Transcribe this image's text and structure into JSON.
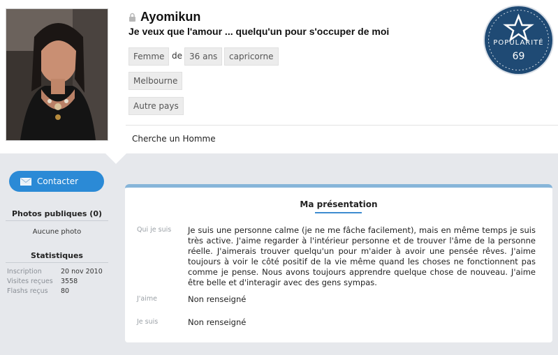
{
  "profile": {
    "name": "Ayomikun",
    "tagline": "Je veux que l'amour ... quelqu'un pour s'occuper de moi",
    "gender": "Femme",
    "age_connector": "de",
    "age": "36 ans",
    "sign": "capricorne",
    "city": "Melbourne",
    "country": "Autre pays",
    "looking_for": "Cherche un Homme"
  },
  "popularity": {
    "label": "POPULARITÉ",
    "value": "69"
  },
  "sidebar": {
    "contact_label": "Contacter",
    "photos_title": "Photos publiques (0)",
    "photos_empty": "Aucune photo",
    "stats_title": "Statistiques",
    "stats": [
      {
        "key": "Inscription",
        "value": "20 nov 2010"
      },
      {
        "key": "Visites reçues",
        "value": "3558"
      },
      {
        "key": "Flashs reçus",
        "value": "80"
      }
    ]
  },
  "presentation": {
    "title": "Ma présentation",
    "rows": [
      {
        "label": "Qui je suis",
        "text": "Je suis une personne calme (je ne me fâche facilement), mais en même temps je suis très active. J'aime regarder à l'intérieur personne et de trouver l'âme de la personne réelle. J'aimerais trouver quelqu'un pour m'aider à avoir une pensée rêves. J'aime toujours à voir le côté positif de la vie même quand les choses ne fonctionnent pas comme je pense. Nous avons toujours apprendre quelque chose de nouveau. J'aime être belle et d'interagir avec des gens sympas."
      },
      {
        "label": "J'aime",
        "text": "Non renseigné"
      },
      {
        "label": "Je suis",
        "text": "Non renseigné"
      }
    ]
  },
  "colors": {
    "accent": "#2b8ad6",
    "badge": "#1f4a74",
    "panel_top": "#87b5d9"
  }
}
